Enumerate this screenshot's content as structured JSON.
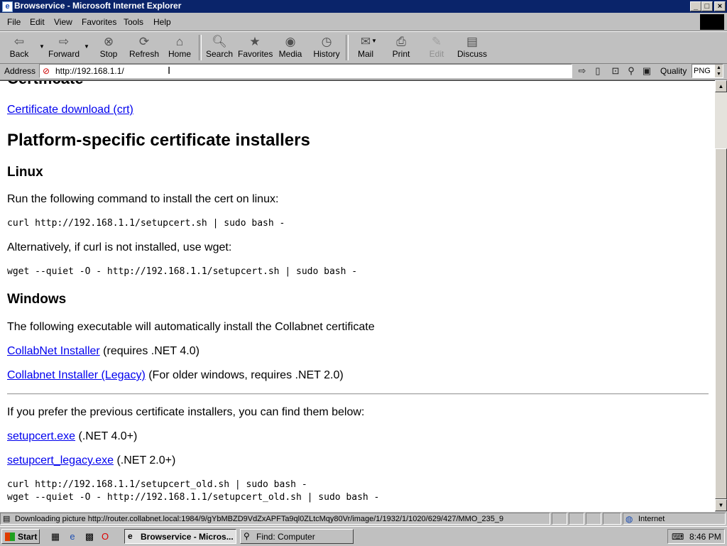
{
  "window": {
    "title": "Browservice - Microsoft Internet Explorer",
    "icon": "ie-icon",
    "controls": [
      "minimize-icon",
      "maximize-icon",
      "close-icon"
    ]
  },
  "menu": [
    "File",
    "Edit",
    "View",
    "Favorites",
    "Tools",
    "Help"
  ],
  "toolbar": {
    "back": "Back",
    "forward": "Forward",
    "stop": "Stop",
    "refresh": "Refresh",
    "home": "Home",
    "search": "Search",
    "favorites": "Favorites",
    "media": "Media",
    "history": "History",
    "mail": "Mail",
    "print": "Print",
    "edit": "Edit",
    "discuss": "Discuss"
  },
  "address": {
    "label": "Address",
    "url": "http://192.168.1.1/",
    "quality_label": "Quality",
    "quality_value": "PNG"
  },
  "page": {
    "partial_heading": "Certificate",
    "cert_download": "Certificate download (crt)",
    "h_platform": "Platform-specific certificate installers",
    "h_linux": "Linux",
    "linux_text": "Run the following command to install the cert on linux:",
    "linux_cmd": "curl http://192.168.1.1/setupcert.sh | sudo bash -",
    "alt_text": "Alternatively, if curl is not installed, use wget:",
    "wget_cmd": "wget --quiet -O - http://192.168.1.1/setupcert.sh | sudo bash -",
    "h_windows": "Windows",
    "windows_text": "The following executable will automatically install the Collabnet certificate",
    "installer_link": "CollabNet Installer",
    "installer_note": " (requires .NET 4.0)",
    "legacy_link": "Collabnet Installer (Legacy)",
    "legacy_note": " (For older windows, requires .NET 2.0)",
    "prev_text": "If you prefer the previous certificate installers, you can find them below:",
    "setupcert_link": "setupcert.exe",
    "setupcert_note": " (.NET 4.0+)",
    "setupcert_legacy_link": "setupcert_legacy.exe",
    "setupcert_legacy_note": " (.NET 2.0+)",
    "old_curl_cmd": "curl http://192.168.1.1/setupcert_old.sh | sudo bash -",
    "old_wget_cmd": "wget --quiet -O - http://192.168.1.1/setupcert_old.sh | sudo bash -"
  },
  "status": {
    "text": "Downloading picture http://router.collabnet.local:1984/9/gYbMBZD9VdZxAPFTa9ql0ZLtcMqy80Vr/image/1/1932/1/1020/629/427/MMO_235_9",
    "zone": "Internet"
  },
  "taskbar": {
    "start": "Start",
    "tasks": [
      "Browservice - Micros...",
      "Find: Computer"
    ],
    "clock": "8:46 PM"
  }
}
